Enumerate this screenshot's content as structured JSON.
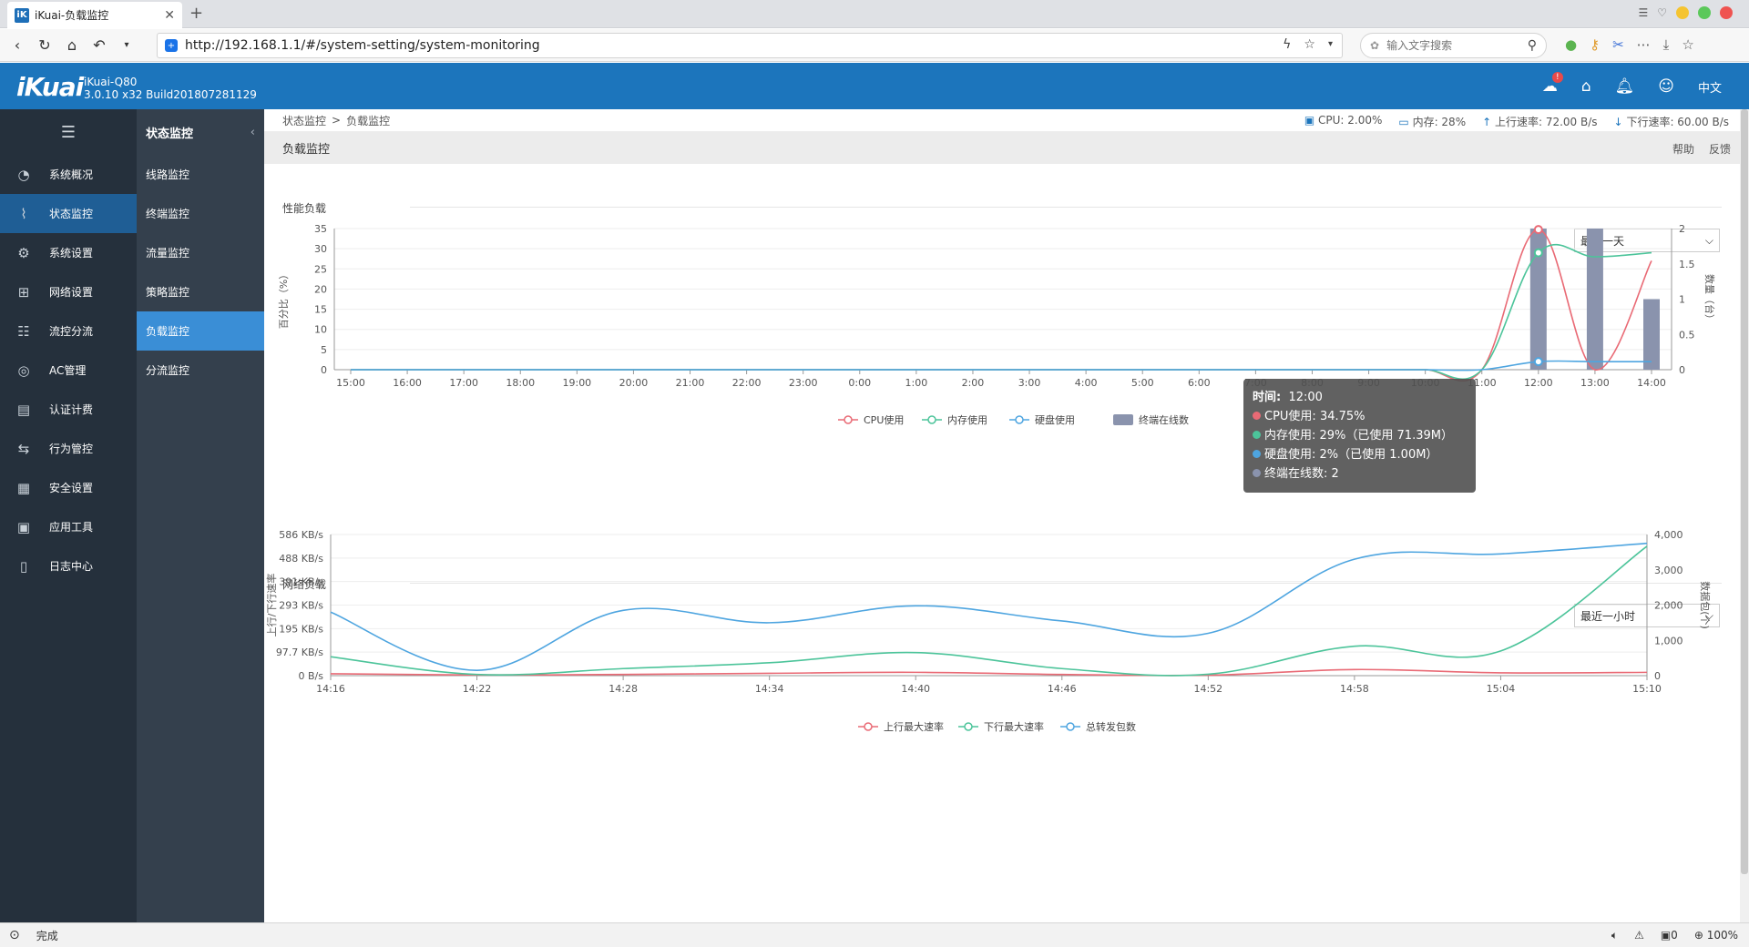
{
  "browser": {
    "tab_title": "iKuai-负载监控",
    "tab_logo": "iK",
    "url": "http://192.168.1.1/#/system-setting/system-monitoring",
    "search_placeholder": "输入文字搜索",
    "status_text": "完成",
    "zoom": "100%",
    "counter": "0"
  },
  "header": {
    "brand": "iKuai",
    "model": "iKuai-Q80",
    "version": "3.0.10 x32 Build201807281129",
    "lang": "中文",
    "badge": "!"
  },
  "sidebar": {
    "items": [
      {
        "label": "系统概况",
        "icon": "dashboard-icon"
      },
      {
        "label": "状态监控",
        "icon": "pulse-icon"
      },
      {
        "label": "系统设置",
        "icon": "gear-icon"
      },
      {
        "label": "网络设置",
        "icon": "network-icon"
      },
      {
        "label": "流控分流",
        "icon": "sliders-icon"
      },
      {
        "label": "AC管理",
        "icon": "wifi-icon"
      },
      {
        "label": "认证计费",
        "icon": "id-card-icon"
      },
      {
        "label": "行为管控",
        "icon": "arrows-icon"
      },
      {
        "label": "安全设置",
        "icon": "firewall-icon"
      },
      {
        "label": "应用工具",
        "icon": "apps-icon"
      },
      {
        "label": "日志中心",
        "icon": "log-icon"
      }
    ]
  },
  "submenu": {
    "title": "状态监控",
    "items": [
      "线路监控",
      "终端监控",
      "流量监控",
      "策略监控",
      "负载监控",
      "分流监控"
    ]
  },
  "breadcrumb": {
    "parent": "状态监控",
    "sep": ">",
    "current": "负载监控"
  },
  "stats": {
    "cpu": "CPU: 2.00%",
    "mem": "内存: 28%",
    "up": "上行速率: 72.00 B/s",
    "down": "下行速率: 60.00 B/s"
  },
  "page": {
    "title": "负载监控",
    "help": "帮助",
    "feedback": "反馈"
  },
  "perf": {
    "section": "性能负载",
    "range": "最近一天",
    "tooltip": {
      "time_label": "时间:",
      "time": "12:00",
      "cpu": "CPU使用: 34.75%",
      "mem": "内存使用: 29%（已使用 71.39M）",
      "disk": "硬盘使用: 2%（已使用 1.00M）",
      "terms": "终端在线数: 2"
    }
  },
  "net": {
    "section": "网络负载",
    "range": "最近一小时"
  },
  "colors": {
    "cpu": "#e96a75",
    "mem": "#4cc49a",
    "disk": "#4ea5e0",
    "bar": "#8a93ad",
    "header": "#1c75bc",
    "sidebar": "#25303c"
  },
  "chart_data": [
    {
      "type": "line",
      "categories": [
        "15:00",
        "16:00",
        "17:00",
        "18:00",
        "19:00",
        "20:00",
        "21:00",
        "22:00",
        "23:00",
        "0:00",
        "1:00",
        "2:00",
        "3:00",
        "4:00",
        "5:00",
        "6:00",
        "7:00",
        "8:00",
        "9:00",
        "10:00",
        "11:00",
        "12:00",
        "13:00",
        "14:00"
      ],
      "ylabel": "百分比（%）",
      "ylabel_right": "数量（台）",
      "ylim": [
        0,
        35
      ],
      "yticks": [
        "0",
        "5",
        "10",
        "15",
        "20",
        "25",
        "30",
        "35"
      ],
      "ylim_right": [
        0,
        2
      ],
      "yticks_right": [
        "0",
        "0.5",
        "1",
        "1.5",
        "2"
      ],
      "series": [
        {
          "name": "CPU使用",
          "type": "line",
          "values": [
            0,
            0,
            0,
            0,
            0,
            0,
            0,
            0,
            0,
            0,
            0,
            0,
            0,
            0,
            0,
            0,
            0,
            0,
            0,
            0,
            0,
            34.75,
            0,
            27
          ]
        },
        {
          "name": "内存使用",
          "type": "line",
          "values": [
            0,
            0,
            0,
            0,
            0,
            0,
            0,
            0,
            0,
            0,
            0,
            0,
            0,
            0,
            0,
            0,
            0,
            0,
            0,
            0,
            0,
            29,
            28,
            29
          ]
        },
        {
          "name": "硬盘使用",
          "type": "line",
          "values": [
            0,
            0,
            0,
            0,
            0,
            0,
            0,
            0,
            0,
            0,
            0,
            0,
            0,
            0,
            0,
            0,
            0,
            0,
            0,
            0,
            0,
            2,
            2,
            2
          ]
        },
        {
          "name": "终端在线数",
          "type": "bar",
          "axis": "right",
          "values": [
            0,
            0,
            0,
            0,
            0,
            0,
            0,
            0,
            0,
            0,
            0,
            0,
            0,
            0,
            0,
            0,
            0,
            0,
            0,
            0,
            0,
            2,
            2,
            1
          ]
        }
      ]
    },
    {
      "type": "line",
      "categories": [
        "14:16",
        "14:22",
        "14:28",
        "14:34",
        "14:40",
        "14:46",
        "14:52",
        "14:58",
        "15:04",
        "15:10"
      ],
      "ylabel": "上行/下行速率",
      "ylabel_right": "数据包(个)",
      "ylim": [
        0,
        600
      ],
      "yticks": [
        "0 B/s",
        "97.7 KB/s",
        "195 KB/s",
        "293 KB/s",
        "391 KB/s",
        "488 KB/s",
        "586 KB/s"
      ],
      "ylim_right": [
        0,
        4000
      ],
      "yticks_right": [
        "0",
        "1,000",
        "2,000",
        "3,000",
        "4,000"
      ],
      "series": [
        {
          "name": "上行最大速率",
          "axis": "left",
          "values": [
            8,
            3,
            5,
            10,
            14,
            5,
            2,
            26,
            12,
            14
          ]
        },
        {
          "name": "下行最大速率",
          "axis": "left",
          "values": [
            80,
            5,
            30,
            55,
            98,
            30,
            6,
            125,
            105,
            550
          ]
        },
        {
          "name": "总转发包数",
          "axis": "right",
          "values": [
            1800,
            150,
            1850,
            1500,
            1980,
            1550,
            1200,
            3300,
            3450,
            3750
          ]
        }
      ]
    }
  ]
}
